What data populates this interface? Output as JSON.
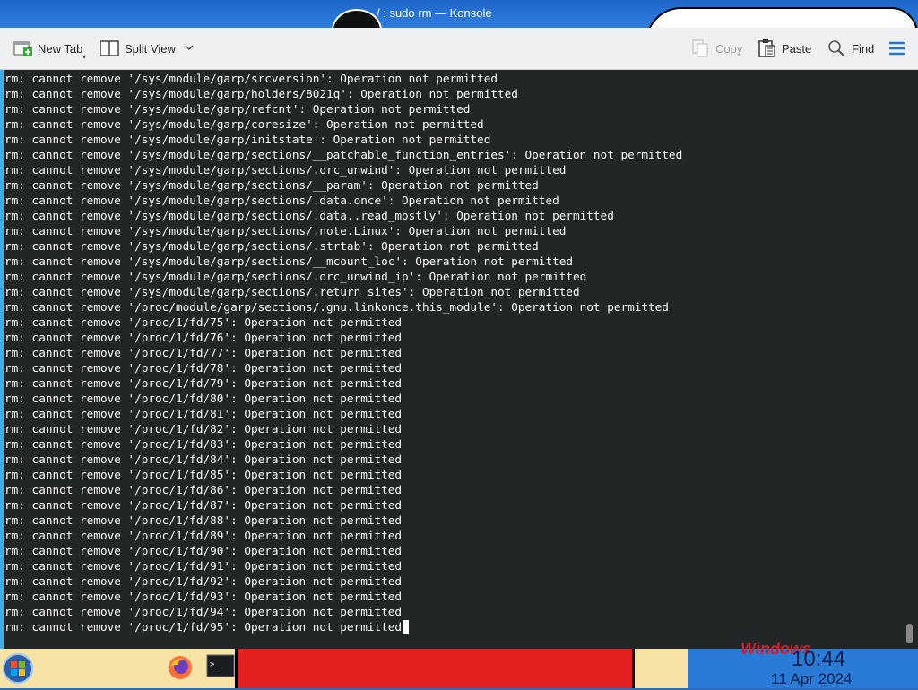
{
  "window": {
    "title": "/ : sudo rm — Konsole"
  },
  "toolbar": {
    "new_tab": "New Tab",
    "split_view": "Split View",
    "copy": "Copy",
    "paste": "Paste",
    "find": "Find",
    "menu_icon": "hamburger-menu-icon"
  },
  "terminal": {
    "lines": [
      "rm: cannot remove '/sys/module/garp/srcversion': Operation not permitted",
      "rm: cannot remove '/sys/module/garp/holders/8021q': Operation not permitted",
      "rm: cannot remove '/sys/module/garp/refcnt': Operation not permitted",
      "rm: cannot remove '/sys/module/garp/coresize': Operation not permitted",
      "rm: cannot remove '/sys/module/garp/initstate': Operation not permitted",
      "rm: cannot remove '/sys/module/garp/sections/__patchable_function_entries': Operation not permitted",
      "rm: cannot remove '/sys/module/garp/sections/.orc_unwind': Operation not permitted",
      "rm: cannot remove '/sys/module/garp/sections/__param': Operation not permitted",
      "rm: cannot remove '/sys/module/garp/sections/.data.once': Operation not permitted",
      "rm: cannot remove '/sys/module/garp/sections/.data..read_mostly': Operation not permitted",
      "rm: cannot remove '/sys/module/garp/sections/.note.Linux': Operation not permitted",
      "rm: cannot remove '/sys/module/garp/sections/.strtab': Operation not permitted",
      "rm: cannot remove '/sys/module/garp/sections/__mcount_loc': Operation not permitted",
      "rm: cannot remove '/sys/module/garp/sections/.orc_unwind_ip': Operation not permitted",
      "rm: cannot remove '/sys/module/garp/sections/.return_sites': Operation not permitted",
      "rm: cannot remove '/proc/module/garp/sections/.gnu.linkonce.this_module': Operation not permitted",
      "rm: cannot remove '/proc/1/fd/75': Operation not permitted",
      "rm: cannot remove '/proc/1/fd/76': Operation not permitted",
      "rm: cannot remove '/proc/1/fd/77': Operation not permitted",
      "rm: cannot remove '/proc/1/fd/78': Operation not permitted",
      "rm: cannot remove '/proc/1/fd/79': Operation not permitted",
      "rm: cannot remove '/proc/1/fd/80': Operation not permitted",
      "rm: cannot remove '/proc/1/fd/81': Operation not permitted",
      "rm: cannot remove '/proc/1/fd/82': Operation not permitted",
      "rm: cannot remove '/proc/1/fd/83': Operation not permitted",
      "rm: cannot remove '/proc/1/fd/84': Operation not permitted",
      "rm: cannot remove '/proc/1/fd/85': Operation not permitted",
      "rm: cannot remove '/proc/1/fd/86': Operation not permitted",
      "rm: cannot remove '/proc/1/fd/87': Operation not permitted",
      "rm: cannot remove '/proc/1/fd/88': Operation not permitted",
      "rm: cannot remove '/proc/1/fd/89': Operation not permitted",
      "rm: cannot remove '/proc/1/fd/90': Operation not permitted",
      "rm: cannot remove '/proc/1/fd/91': Operation not permitted",
      "rm: cannot remove '/proc/1/fd/92': Operation not permitted",
      "rm: cannot remove '/proc/1/fd/93': Operation not permitted",
      "rm: cannot remove '/proc/1/fd/94': Operation not permitted",
      "rm: cannot remove '/proc/1/fd/95': Operation not permitted"
    ]
  },
  "taskbar": {
    "clock_time": "10:44",
    "clock_date": "11 Apr 2024",
    "terminal_task_label": ">_"
  },
  "colors": {
    "terminal_bg": "#232627",
    "terminal_fg": "#fcfcfc",
    "accent": "#3daee9"
  }
}
